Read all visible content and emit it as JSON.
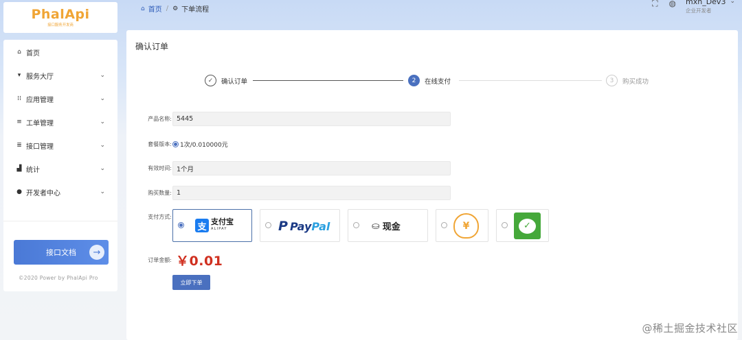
{
  "logo": {
    "text": "PhalApi",
    "subtitle": "接口服务开发商"
  },
  "sidebar": {
    "items": [
      {
        "label": "首页",
        "icon": "home-icon",
        "glyph": "⌂",
        "has_children": false
      },
      {
        "label": "服务大厅",
        "icon": "cart-icon",
        "glyph": "▾",
        "has_children": true
      },
      {
        "label": "应用管理",
        "icon": "grid-icon",
        "glyph": "⋮⋮",
        "has_children": true
      },
      {
        "label": "工单管理",
        "icon": "list-icon",
        "glyph": "≡",
        "has_children": true
      },
      {
        "label": "接口管理",
        "icon": "list-icon",
        "glyph": "≣",
        "has_children": true
      },
      {
        "label": "统计",
        "icon": "bar-chart-icon",
        "glyph": "▮",
        "has_children": true
      },
      {
        "label": "开发者中心",
        "icon": "user-icon",
        "glyph": "●",
        "has_children": true
      }
    ],
    "doc_button": "接口文档",
    "copyright": "©2020 Power by PhalApi Pro"
  },
  "breadcrumb": {
    "home": "首页",
    "current": "下单流程"
  },
  "user": {
    "name": "mxh_Dev3",
    "role": "企业开发者"
  },
  "page": {
    "title": "确认订单",
    "steps": [
      {
        "label": "确认订单",
        "state": "done",
        "marker": "✓"
      },
      {
        "label": "在线支付",
        "state": "active",
        "marker": "2"
      },
      {
        "label": "购买成功",
        "state": "pending",
        "marker": "3"
      }
    ],
    "form": {
      "product_label": "产品名称:",
      "product_value": "5445",
      "package_label": "套餐版本:",
      "package_value": "1次/0.010000元",
      "validity_label": "有效时间:",
      "validity_value": "1个月",
      "quantity_label": "购买数量:",
      "quantity_value": "1",
      "payment_label": "支付方式:",
      "amount_label": "订单金额:",
      "amount_value": "￥0.01"
    },
    "payment_methods": [
      {
        "name": "alipay",
        "cn": "支付宝",
        "en": "ALIPAY",
        "selected": true
      },
      {
        "name": "paypal",
        "text_a": "Pay",
        "text_b": "Pal",
        "selected": false
      },
      {
        "name": "cash",
        "text": "现金",
        "selected": false
      },
      {
        "name": "money-bag",
        "symbol": "¥",
        "selected": false
      },
      {
        "name": "wechat",
        "selected": false
      }
    ],
    "submit_label": "立即下单"
  },
  "watermark": "@稀土掘金技术社区",
  "colors": {
    "primary": "#4a70bf",
    "amount": "#d03020",
    "logo": "#f0a535",
    "alipay": "#1a7cf0",
    "wechat": "#45a83a"
  }
}
